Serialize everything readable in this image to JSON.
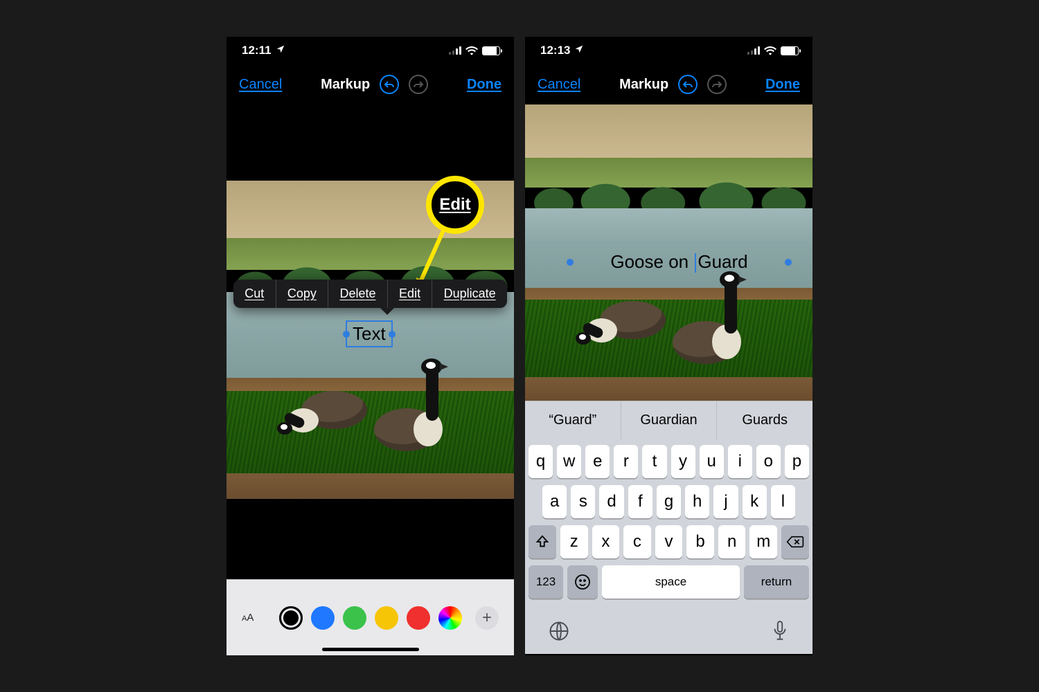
{
  "left": {
    "status": {
      "time": "12:11"
    },
    "nav": {
      "cancel": "Cancel",
      "title": "Markup",
      "done": "Done"
    },
    "popover": {
      "cut": "Cut",
      "copy": "Copy",
      "delete": "Delete",
      "edit": "Edit",
      "duplicate": "Duplicate"
    },
    "callout_label": "Edit",
    "textbox_value": "Text",
    "colors": {
      "black": "#000000",
      "blue": "#1f78ff",
      "green": "#3ac24b",
      "yellow": "#f6c506",
      "red": "#f0302e",
      "rainbow": "conic-gradient(red,orange,yellow,lime,cyan,blue,magenta,red)"
    }
  },
  "right": {
    "status": {
      "time": "12:13"
    },
    "nav": {
      "cancel": "Cancel",
      "title": "Markup",
      "done": "Done"
    },
    "editing_text_pre": "Goose on ",
    "editing_text_post": "Guard",
    "predictions": {
      "p1": "“Guard”",
      "p2": "Guardian",
      "p3": "Guards"
    },
    "keys": {
      "row1": [
        "q",
        "w",
        "e",
        "r",
        "t",
        "y",
        "u",
        "i",
        "o",
        "p"
      ],
      "row2": [
        "a",
        "s",
        "d",
        "f",
        "g",
        "h",
        "j",
        "k",
        "l"
      ],
      "row3": [
        "z",
        "x",
        "c",
        "v",
        "b",
        "n",
        "m"
      ],
      "num": "123",
      "space": "space",
      "ret": "return"
    }
  }
}
